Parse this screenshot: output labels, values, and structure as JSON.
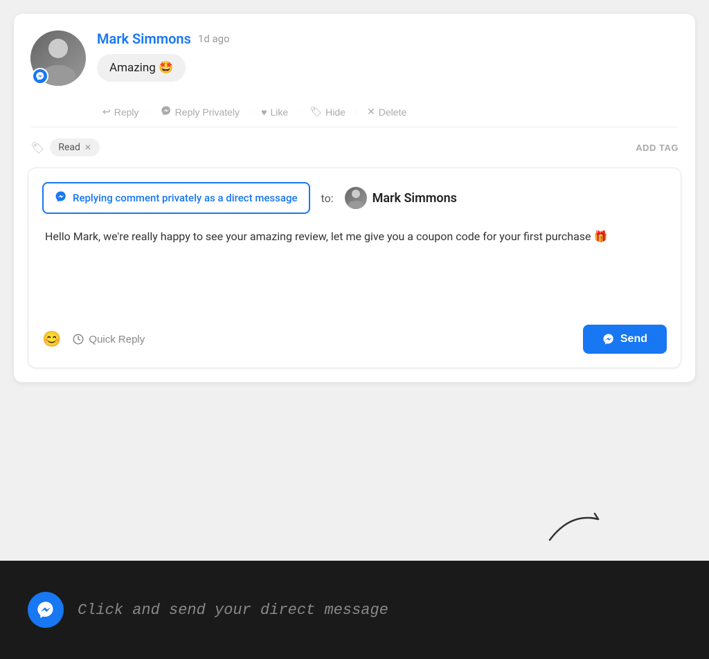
{
  "header": {
    "author": "Mark Simmons",
    "time": "1d ago",
    "comment_text": "Amazing 🤩",
    "avatar_badge": "↑"
  },
  "actions": {
    "reply": "Reply",
    "reply_privately": "Reply Privately",
    "like": "Like",
    "hide": "Hide",
    "delete": "Delete"
  },
  "tags": {
    "tag_label": "Read",
    "add_tag": "ADD TAG"
  },
  "reply_box": {
    "dm_label": "Replying comment privately as a direct message",
    "to_label": "to:",
    "recipient": "Mark Simmons",
    "body_text": "Hello Mark, we're really happy to see your amazing review, let me give you a coupon code for your first purchase 🎁",
    "emoji_placeholder": "😊",
    "quick_reply": "Quick Reply",
    "send_button": "Send"
  },
  "bottom_bar": {
    "text": "Click and send  your direct message"
  },
  "icons": {
    "messenger": "💬",
    "reply_arrow": "↩",
    "like_heart": "♥",
    "hide_icon": "🏷",
    "delete_x": "✕",
    "tag_icon": "🏷",
    "emoji_icon": "☺",
    "clock_icon": "🕐"
  }
}
